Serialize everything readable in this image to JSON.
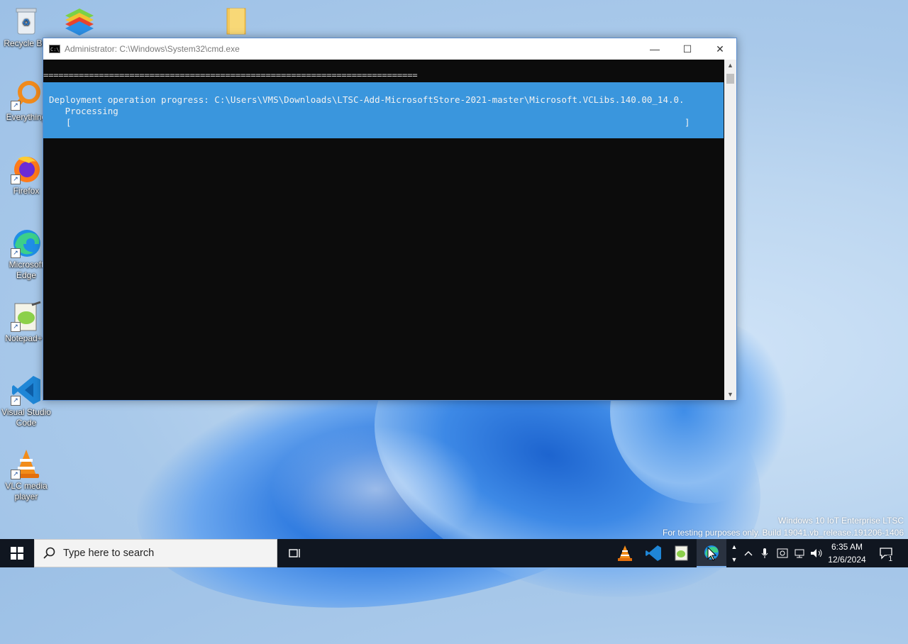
{
  "desktop": {
    "icons": [
      {
        "label": "Recycle Bin"
      },
      {
        "label": "Everything"
      },
      {
        "label": "Firefox"
      },
      {
        "label": "Microsoft Edge"
      },
      {
        "label": "Notepad++"
      },
      {
        "label": "Visual Studio Code"
      },
      {
        "label": "VLC media player"
      }
    ],
    "watermark": {
      "line1": "Windows 10 IoT Enterprise LTSC",
      "line2": "For testing purposes only. Build 19041.vb_release.191206-1406"
    }
  },
  "window": {
    "title": "Administrator: C:\\Windows\\System32\\cmd.exe",
    "controls": {
      "minimize": "—",
      "maximize": "☐",
      "close": "✕"
    }
  },
  "console": {
    "separator": "==========================================================================",
    "progress": {
      "line1": "Deployment operation progress: C:\\Users\\VMS\\Downloads\\LTSC-Add-MicrosoftStore-2021-master\\Microsoft.VCLibs.140.00_14.0.",
      "line2": "   Processing",
      "bar_open": "[",
      "bar_close": "]",
      "percent": 0
    }
  },
  "taskbar": {
    "search_placeholder": "Type here to search",
    "clock": {
      "time": "6:35 AM",
      "date": "12/6/2024"
    },
    "notification_count": "1"
  },
  "colors": {
    "console_bg": "#0c0c0c",
    "progress_bg": "#3a96dd",
    "taskbar_bg": "#101620"
  }
}
